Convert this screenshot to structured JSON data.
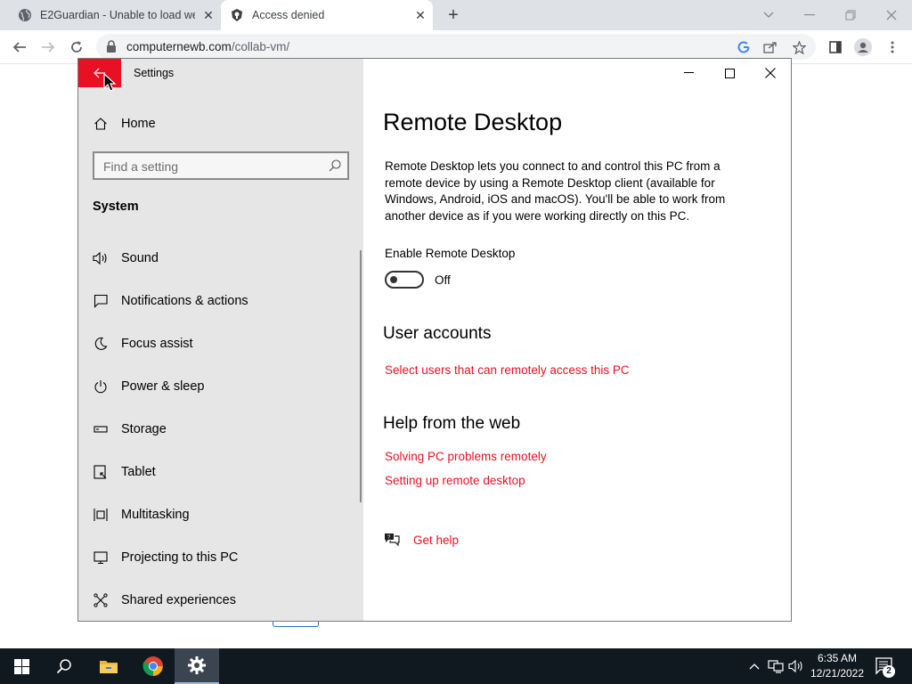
{
  "browser": {
    "tabs": [
      {
        "title": "E2Guardian - Unable to load web page",
        "icon": "globe-icon"
      },
      {
        "title": "Access denied",
        "icon": "shield-icon"
      }
    ],
    "url_host": "computernewb.com",
    "url_path": "/collab-vm/"
  },
  "settings": {
    "window_title": "Settings",
    "home_label": "Home",
    "search_placeholder": "Find a setting",
    "section_label": "System",
    "nav_items": [
      {
        "label": "Sound",
        "icon": "speaker-icon"
      },
      {
        "label": "Notifications & actions",
        "icon": "notification-icon"
      },
      {
        "label": "Focus assist",
        "icon": "moon-icon"
      },
      {
        "label": "Power & sleep",
        "icon": "power-icon"
      },
      {
        "label": "Storage",
        "icon": "storage-icon"
      },
      {
        "label": "Tablet",
        "icon": "tablet-icon"
      },
      {
        "label": "Multitasking",
        "icon": "multitasking-icon"
      },
      {
        "label": "Projecting to this PC",
        "icon": "projecting-icon"
      },
      {
        "label": "Shared experiences",
        "icon": "shared-experiences-icon"
      }
    ],
    "page_title": "Remote Desktop",
    "description": "Remote Desktop lets you connect to and control this PC from a remote device by using a Remote Desktop client (available for Windows, Android, iOS and macOS). You'll be able to work from another device as if you were working directly on this PC.",
    "toggle_label": "Enable Remote Desktop",
    "toggle_state": "Off",
    "toggle_on": false,
    "user_accounts_heading": "User accounts",
    "user_accounts_link": "Select users that can remotely access this PC",
    "help_heading": "Help from the web",
    "help_links": [
      "Solving PC problems remotely",
      "Setting up remote desktop"
    ],
    "get_help": "Get help",
    "accent_color": "#e81123"
  },
  "taskbar": {
    "time": "6:35 AM",
    "date": "12/21/2022",
    "notification_count": "2",
    "background_color": "#101820"
  }
}
